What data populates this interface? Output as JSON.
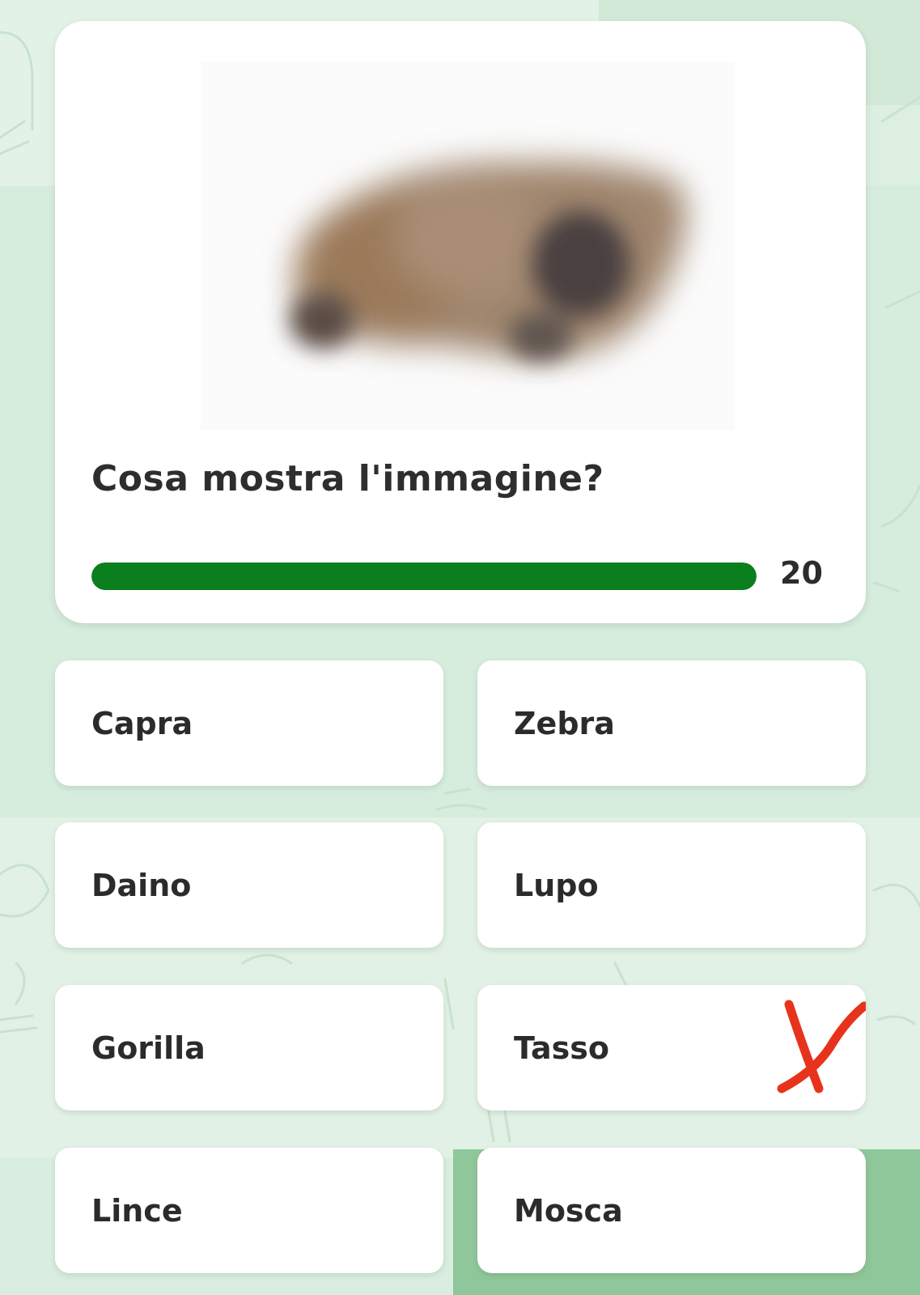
{
  "quiz": {
    "question": "Cosa mostra l'immagine?",
    "timer_value": "20",
    "progress_fraction": 1.0,
    "progress_color": "#0b7f1d"
  },
  "answers": [
    {
      "label": "Capra"
    },
    {
      "label": "Zebra"
    },
    {
      "label": "Daino"
    },
    {
      "label": "Lupo"
    },
    {
      "label": "Gorilla"
    },
    {
      "label": "Tasso"
    },
    {
      "label": "Lince"
    },
    {
      "label": "Mosca"
    }
  ],
  "annotation": {
    "marked_answer": "Tasso",
    "color": "#e8331c"
  },
  "colors": {
    "background": "#dcefe1",
    "card": "#ffffff",
    "text": "#2e2e2e"
  }
}
